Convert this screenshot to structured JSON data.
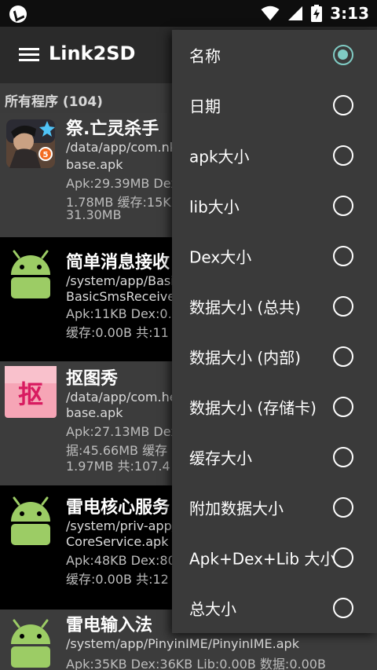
{
  "status_bar": {
    "time": "3:13"
  },
  "app_bar": {
    "title": "Link2SD"
  },
  "section": {
    "title": "所有程序 (104)"
  },
  "apps": [
    {
      "name": "祭.亡灵杀手",
      "lines": [
        "/data/app/com.nk",
        "base.apk",
        "Apk:29.39MB  Dex",
        "1.78MB  缓存:15K",
        "31.30MB"
      ]
    },
    {
      "name": "简单消息接收",
      "lines": [
        "/system/app/Basi",
        "BasicSmsReceive",
        "Apk:11KB  Dex:0.0",
        "缓存:0.00B  共:11"
      ]
    },
    {
      "name": "抠图秀",
      "lines": [
        "/data/app/com.he",
        "base.apk",
        "Apk:27.13MB  Dex",
        "据:45.66MB  缓存",
        "1.97MB  共:107.4"
      ]
    },
    {
      "name": "雷电核心服务",
      "lines": [
        "/system/priv-app/",
        "CoreService.apk",
        "Apk:48KB  Dex:80",
        "缓存:0.00B  共:12"
      ]
    },
    {
      "name": "雷电输入法",
      "lines": [
        "/system/app/PinyinIME/PinyinIME.apk",
        "Apk:35KB  Dex:36KB  Lib:0.00B  数据:0.00B"
      ]
    }
  ],
  "sort_menu": {
    "selected_index": 0,
    "items": [
      "名称",
      "日期",
      "apk大小",
      "lib大小",
      "Dex大小",
      "数据大小 (总共)",
      "数据大小 (内部)",
      "数据大小 (存储卡)",
      "缓存大小",
      "附加数据大小",
      "Apk+Dex+Lib 大小",
      "总大小"
    ]
  },
  "colors": {
    "accent": "#80cbc4",
    "popup_bg": "#3a3a3a",
    "appbar_bg": "#2a2a2a"
  }
}
